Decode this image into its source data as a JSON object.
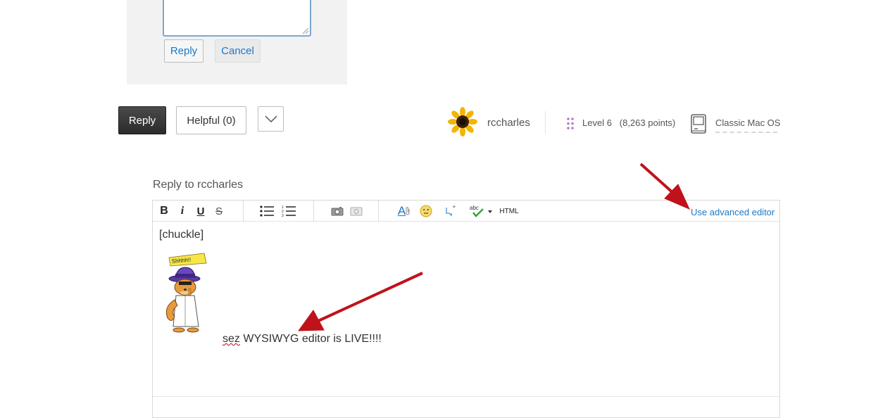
{
  "top_reply": {
    "reply_label": "Reply",
    "cancel_label": "Cancel"
  },
  "actions": {
    "reply_label": "Reply",
    "helpful_label": "Helpful (0)"
  },
  "author": {
    "username": "rccharles",
    "level": "Level 6",
    "points": "(8,263 points)",
    "os": "Classic Mac OS"
  },
  "editor": {
    "reply_to": "Reply to rccharles",
    "advanced_link": "Use advanced editor",
    "toolbar": {
      "html_label": "HTML",
      "bold": "B",
      "italic": "i",
      "underline": "U",
      "strike": "S",
      "font_color": "A"
    },
    "body": {
      "line1": "[chuckle]",
      "line2_word1": "sez",
      "line2_rest": " WYSIWYG editor is LIVE!!!!"
    }
  },
  "colors": {
    "link": "#1a7ac9",
    "reply_button": "#333333",
    "annotation_arrow": "#c0121a"
  }
}
